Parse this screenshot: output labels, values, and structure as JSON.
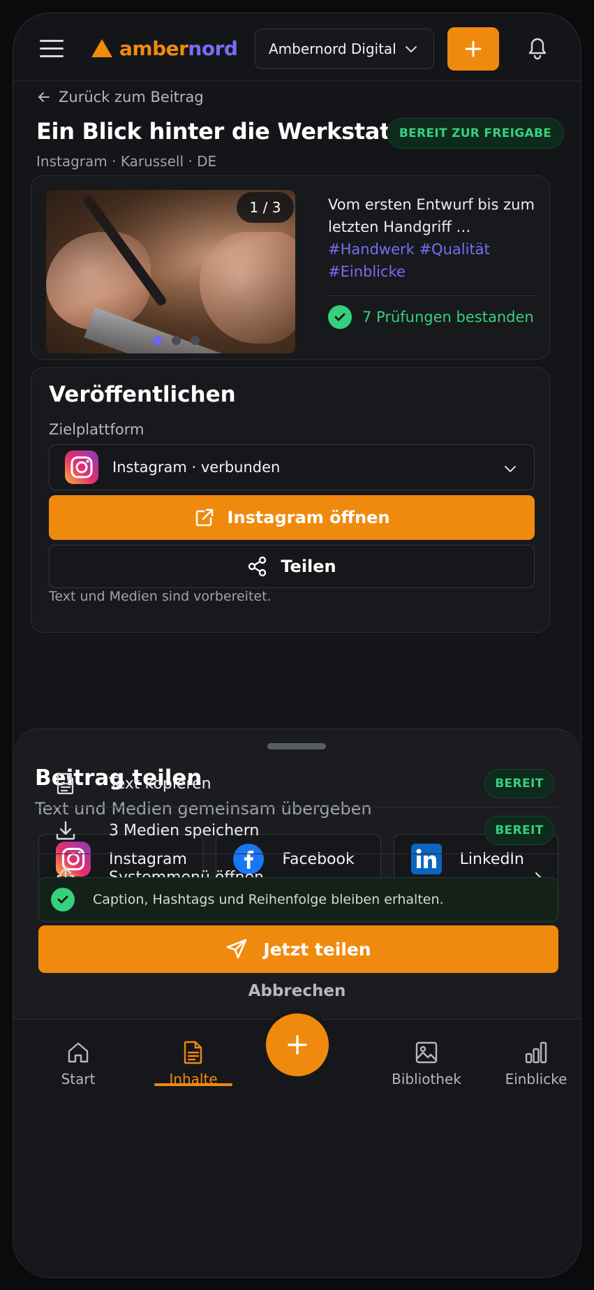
{
  "header": {
    "brand_part1": "amber",
    "brand_part2": "nord",
    "workspace": "Ambernord Digital",
    "menu_icon": "hamburger-icon",
    "add_icon": "plus-icon",
    "notifications_icon": "bell-icon"
  },
  "post": {
    "back_label": "Zurück zum Beitrag",
    "title": "Ein Blick hinter die Werkstatt",
    "status": "BEREIT ZUR FREIGABE",
    "meta": "Instagram · Karussell · DE"
  },
  "preview": {
    "counter": "1 / 3",
    "slide_count": 3,
    "active_slide": 1,
    "caption": "Vom ersten Entwurf bis zum letzten Handgriff …",
    "hashtags": "#Handwerk #Qualität #Einblicke",
    "checks": "7 Prüfungen bestanden"
  },
  "publish": {
    "title": "Veröffentlichen",
    "target_label": "Zielplattform",
    "platform": "Instagram",
    "platform_status": "verbunden",
    "open_button": "Instagram öffnen",
    "share_button": "Teilen",
    "note": "Text und Medien sind vorbereitet."
  },
  "sheet": {
    "title": "Beitrag teilen",
    "subtitle": "Text und Medien gemeinsam übergeben",
    "targets": [
      {
        "label": "Instagram",
        "icon": "instagram-icon"
      },
      {
        "label": "Facebook",
        "icon": "facebook-icon"
      },
      {
        "label": "LinkedIn",
        "icon": "linkedin-icon"
      }
    ],
    "actions": [
      {
        "label": "Text kopieren",
        "icon": "document-icon",
        "badge": "BEREIT"
      },
      {
        "label": "3 Medien speichern",
        "icon": "download-icon",
        "badge": "BEREIT"
      },
      {
        "label": "Systemmenü öffnen",
        "icon": "share-out-icon"
      }
    ],
    "info": "Caption, Hashtags und Reihenfolge bleiben erhalten.",
    "share_now": "Jetzt teilen",
    "cancel": "Abbrechen"
  },
  "tabs": [
    {
      "label": "Start",
      "icon": "home-icon"
    },
    {
      "label": "Inhalte",
      "icon": "document-icon",
      "active": true
    },
    {
      "label": "Bibliothek",
      "icon": "image-icon"
    },
    {
      "label": "Einblicke",
      "icon": "bar-chart-icon"
    }
  ],
  "colors": {
    "accent": "#f08a0e",
    "brand_secondary": "#7b6cf6",
    "success": "#36d07d",
    "background": "#141518"
  }
}
